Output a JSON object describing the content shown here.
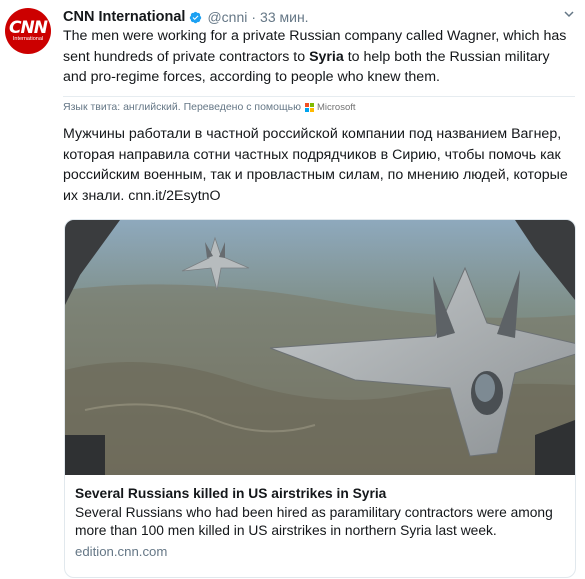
{
  "account": {
    "name": "CNN International",
    "handle": "@cnni",
    "separator": "·",
    "time": "33 мин.",
    "avatar_logo": "CNN",
    "avatar_sub": "International"
  },
  "tweet": {
    "text_before": "The men were working for a private Russian company called Wagner, which has sent hundreds of private contractors to ",
    "text_bold": "Syria",
    "text_after": " to help both the Russian military and pro-regime forces, according to people who knew them."
  },
  "translation": {
    "note": "Язык твита: английский. Переведено с помощью",
    "provider": "Microsoft",
    "text": "Мужчины работали в частной российской компании под названием Вагнер, которая направила сотни частных подрядчиков в Сирию, чтобы помочь как российским военным, так и провластным силам, по мнению людей, которые их знали.",
    "link": "cnn.it/2EsytnO"
  },
  "card": {
    "title": "Several Russians killed in US airstrikes in Syria",
    "description": "Several Russians who had been hired as paramilitary contractors were among more than 100 men killed in US airstrikes in northern Syria last week.",
    "domain": "edition.cnn.com"
  },
  "colors": {
    "cnn_red": "#cc0000",
    "verified_blue": "#1da1f2",
    "link_blue": "#1b95e0",
    "muted": "#657786"
  },
  "icons": [
    "verified-badge-icon",
    "chevron-down-icon",
    "microsoft-logo-icon"
  ]
}
